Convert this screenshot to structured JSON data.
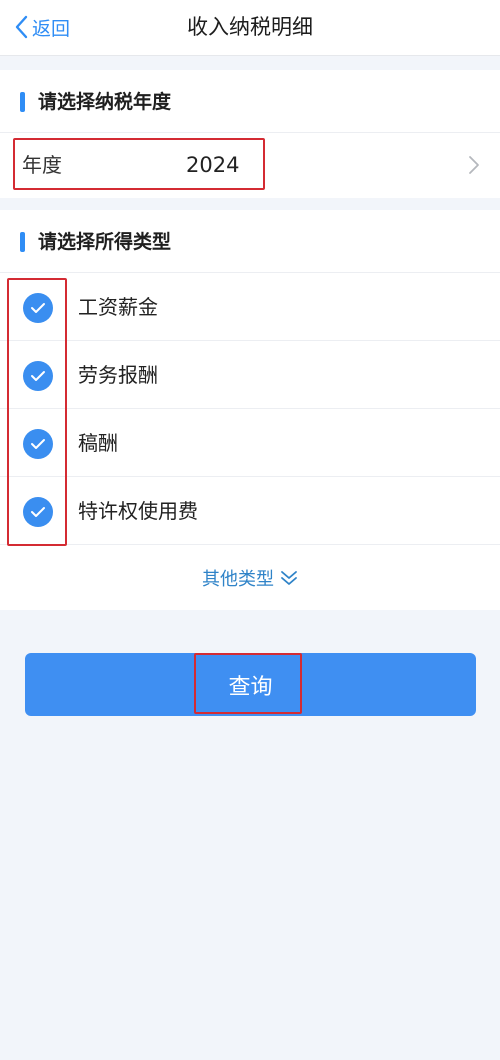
{
  "header": {
    "back_label": "返回",
    "title": "收入纳税明细"
  },
  "year_section": {
    "title": "请选择纳税年度",
    "field_label": "年度",
    "field_value": "2024"
  },
  "type_section": {
    "title": "请选择所得类型",
    "items": [
      {
        "label": "工资薪金",
        "checked": true
      },
      {
        "label": "劳务报酬",
        "checked": true
      },
      {
        "label": "稿酬",
        "checked": true
      },
      {
        "label": "特许权使用费",
        "checked": true
      }
    ],
    "more_label": "其他类型"
  },
  "actions": {
    "query_label": "查询"
  },
  "colors": {
    "accent": "#3f8ff2",
    "highlight_border": "#d42b33",
    "background": "#f2f5fa"
  }
}
